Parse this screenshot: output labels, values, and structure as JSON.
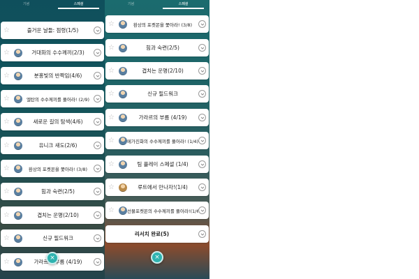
{
  "left_panel": {
    "tabs": [
      "기념",
      "스페셜"
    ],
    "items": [
      {
        "label": "즐거운 날들: 점령(1/5)",
        "avatar": false
      },
      {
        "label": "거대화의 수수께끼(2/3)",
        "avatar": true
      },
      {
        "label": "분홍빛의 반짝임(4/6)",
        "avatar": true
      },
      {
        "label": "엘탄의 수수께끼를 풀어라! (2/9)",
        "avatar": true
      },
      {
        "label": "새로운 길의 탐색(4/6)",
        "avatar": true
      },
      {
        "label": "유니크 섀도(2/6)",
        "avatar": true
      },
      {
        "label": "환상의 포켓몬을 쫓아라! (3/8)",
        "avatar": true
      },
      {
        "label": "힘과 숙련(2/5)",
        "avatar": true
      },
      {
        "label": "겹치는 운명(2/10)",
        "avatar": true
      },
      {
        "label": "신규 필드워크",
        "avatar": true
      },
      {
        "label": "가라르의 부름 (4/19)",
        "avatar": true
      }
    ]
  },
  "right_panel": {
    "tabs": [
      "기념",
      "스페셜"
    ],
    "items": [
      {
        "label": "환상의 포켓몬을 쫓아라! (3/8)",
        "avatar": true
      },
      {
        "label": "힘과 숙련(2/5)",
        "avatar": true
      },
      {
        "label": "겹치는 운명(2/10)",
        "avatar": true
      },
      {
        "label": "신규 필드워크",
        "avatar": true
      },
      {
        "label": "가라르의 부름 (4/19)",
        "avatar": true
      },
      {
        "label": "메가진화의 수수께끼를 풀어라! (1/4)",
        "avatar": true
      },
      {
        "label": "팀 플레이 스페셜 (1/4)",
        "avatar": true
      },
      {
        "label": "루트에서 만나자!(1/4)",
        "avatar": true
      },
      {
        "label": "선물포켓몬의 수수께끼를 풀어라!(1/6)",
        "avatar": true
      },
      {
        "label": "리서치 완료(5)",
        "avatar": false
      }
    ]
  },
  "close_button": "×"
}
